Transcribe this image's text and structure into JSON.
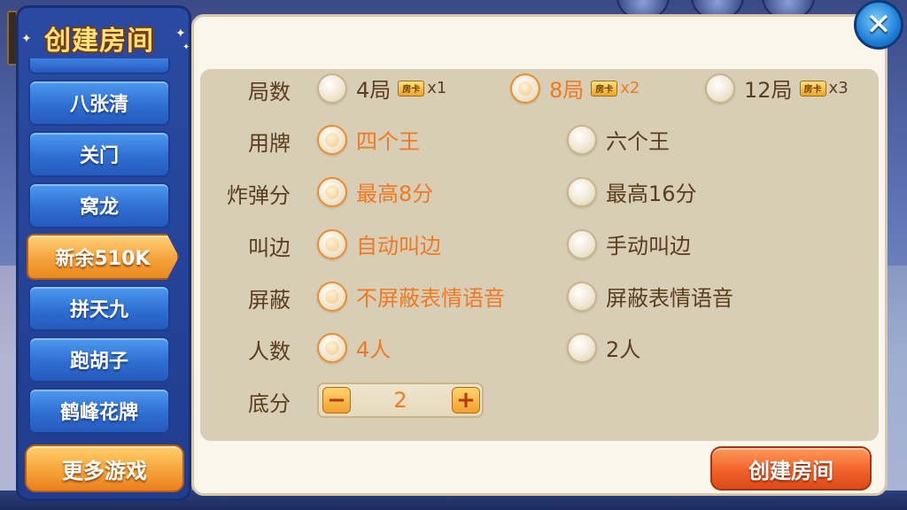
{
  "sidebar": {
    "title": "创建房间",
    "items": [
      {
        "label": "八张清",
        "active": false
      },
      {
        "label": "关门",
        "active": false
      },
      {
        "label": "窝龙",
        "active": false
      },
      {
        "label": "新余510K",
        "active": true
      },
      {
        "label": "拼天九",
        "active": false
      },
      {
        "label": "跑胡子",
        "active": false
      },
      {
        "label": "鹤峰花牌",
        "active": false
      }
    ],
    "more_label": "更多游戏"
  },
  "settings": {
    "rounds": {
      "label": "局数",
      "options": [
        {
          "text": "4局",
          "card": "房卡",
          "mult": "x1",
          "checked": false
        },
        {
          "text": "8局",
          "card": "房卡",
          "mult": "x2",
          "checked": true
        },
        {
          "text": "12局",
          "card": "房卡",
          "mult": "x3",
          "checked": false
        }
      ]
    },
    "cards": {
      "label": "用牌",
      "options": [
        {
          "text": "四个王",
          "checked": true
        },
        {
          "text": "六个王",
          "checked": false
        }
      ]
    },
    "bomb": {
      "label": "炸弹分",
      "options": [
        {
          "text": "最高8分",
          "checked": true
        },
        {
          "text": "最高16分",
          "checked": false
        }
      ]
    },
    "call": {
      "label": "叫边",
      "options": [
        {
          "text": "自动叫边",
          "checked": true
        },
        {
          "text": "手动叫边",
          "checked": false
        }
      ]
    },
    "block": {
      "label": "屏蔽",
      "options": [
        {
          "text": "不屏蔽表情语音",
          "checked": true
        },
        {
          "text": "屏蔽表情语音",
          "checked": false
        }
      ]
    },
    "players": {
      "label": "人数",
      "options": [
        {
          "text": "4人",
          "checked": true
        },
        {
          "text": "2人",
          "checked": false
        }
      ]
    },
    "base": {
      "label": "底分",
      "value": "2",
      "minus": "−",
      "plus": "+"
    }
  },
  "create_label": "创建房间",
  "close_label": "✕",
  "icons": {
    "close": "close-icon",
    "card": "room-card-icon"
  },
  "colors": {
    "accent": "#f07a22",
    "text": "#5a3e1e",
    "nav_blue": "#2f6fd2",
    "nav_active": "#f6a23c"
  }
}
